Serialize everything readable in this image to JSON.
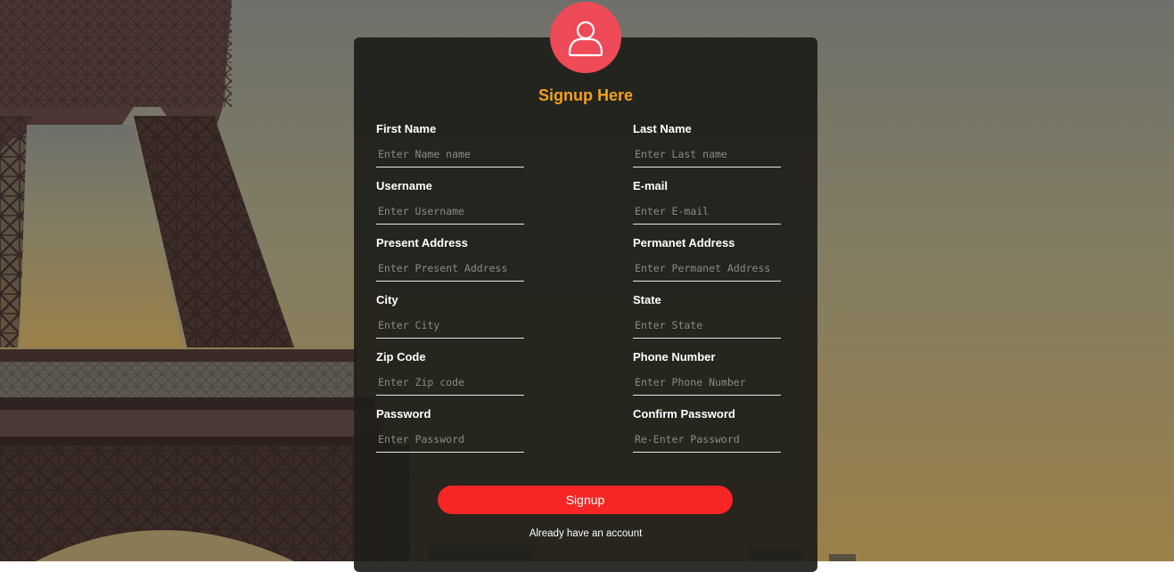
{
  "form": {
    "title": "Signup Here",
    "avatar_icon": "user-icon",
    "accent_color": "#f4a01e",
    "avatar_color": "#ef4a57",
    "button_color": "#f82525",
    "fields": [
      {
        "label": "First Name",
        "placeholder": "Enter Name name",
        "value": ""
      },
      {
        "label": "Last Name",
        "placeholder": "Enter Last name",
        "value": ""
      },
      {
        "label": "Username",
        "placeholder": "Enter Username",
        "value": ""
      },
      {
        "label": "E-mail",
        "placeholder": "Enter E-mail",
        "value": ""
      },
      {
        "label": "Present Address",
        "placeholder": "Enter Present Address",
        "value": ""
      },
      {
        "label": "Permanet Address",
        "placeholder": "Enter Permanet Address",
        "value": ""
      },
      {
        "label": "City",
        "placeholder": "Enter City",
        "value": ""
      },
      {
        "label": "State",
        "placeholder": "Enter State",
        "value": ""
      },
      {
        "label": "Zip Code",
        "placeholder": "Enter Zip code",
        "value": ""
      },
      {
        "label": "Phone Number",
        "placeholder": "Enter Phone Number",
        "value": ""
      },
      {
        "label": "Password",
        "placeholder": "Enter Password",
        "value": ""
      },
      {
        "label": "Confirm Password",
        "placeholder": "Re-Enter Password",
        "value": ""
      }
    ],
    "submit_label": "Signup",
    "login_link": "Already have an account"
  }
}
